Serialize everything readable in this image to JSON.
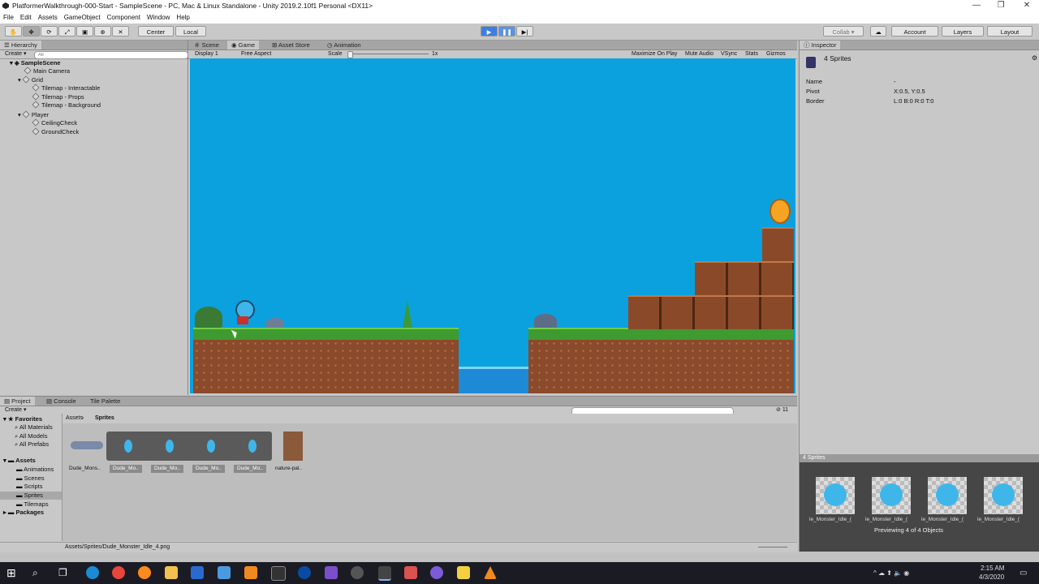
{
  "window": {
    "title": "PlatformerWalkthrough-000-Start - SampleScene - PC, Mac & Linux Standalone - Unity 2019.2.10f1 Personal <DX11>",
    "minimize": "—",
    "maximize": "❐",
    "close": "✕"
  },
  "menu": [
    "File",
    "Edit",
    "Assets",
    "GameObject",
    "Component",
    "Window",
    "Help"
  ],
  "toolbar": {
    "pivot": "Center",
    "space": "Local",
    "collab": "Collab ▾",
    "account": "Account",
    "layers": "Layers",
    "layout": "Layout"
  },
  "hierarchy": {
    "tab": "Hierarchy",
    "create": "Create ▾",
    "search_placeholder": "All",
    "scene": "SampleScene",
    "items": [
      "Main Camera",
      "Grid",
      "Tilemap - Interactable",
      "Tilemap - Props",
      "Tilemap - Background",
      "Player",
      "CeilingCheck",
      "GroundCheck"
    ]
  },
  "game": {
    "tabs": [
      "Scene",
      "Game",
      "Asset Store",
      "Animation"
    ],
    "display": "Display 1",
    "aspect": "Free Aspect",
    "scale_label": "Scale",
    "scale_value": "1x",
    "options": [
      "Maximize On Play",
      "Mute Audio",
      "VSync",
      "Stats",
      "Gizmos"
    ]
  },
  "inspector": {
    "tab": "Inspector",
    "header": "4 Sprites",
    "rows": [
      {
        "label": "Name",
        "value": "-"
      },
      {
        "label": "Pivot",
        "value": "X:0.5, Y:0.5"
      },
      {
        "label": "Border",
        "value": "L:0 B:0 R:0 T:0"
      }
    ],
    "preview_title": "4 Sprites",
    "preview_labels": [
      "le_Monster_Idle_(",
      "le_Monster_Idle_(",
      "le_Monster_Idle_(",
      "le_Monster_Idle_("
    ],
    "preview_status": "Previewing 4 of 4 Objects"
  },
  "project": {
    "tabs": [
      "Project",
      "Console",
      "Tile Palette"
    ],
    "create": "Create ▾",
    "breadcrumb": [
      "Assets",
      "Sprites"
    ],
    "count": "11",
    "favorites": [
      "Favorites",
      "All Materials",
      "All Models",
      "All Prefabs"
    ],
    "assets": [
      "Assets",
      "Animations",
      "Scenes",
      "Scripts",
      "Sprites",
      "Tilemaps",
      "Packages"
    ],
    "files": [
      "Dude_Mons..",
      "Dude_Mo..",
      "Dude_Mo..",
      "Dude_Mo..",
      "Dude_Mo..",
      "nature-pal.."
    ],
    "status": "Assets/Sprites/Dude_Monster_Idle_4.png"
  },
  "taskbar": {
    "time": "2:15 AM",
    "date": "4/3/2020"
  },
  "colors": {
    "sky": "#0aa1de",
    "grass": "#3f9a2f",
    "dirt": "#8b4a2b",
    "crate": "#8a4a2a",
    "play_accent": "#3d7fe0"
  }
}
